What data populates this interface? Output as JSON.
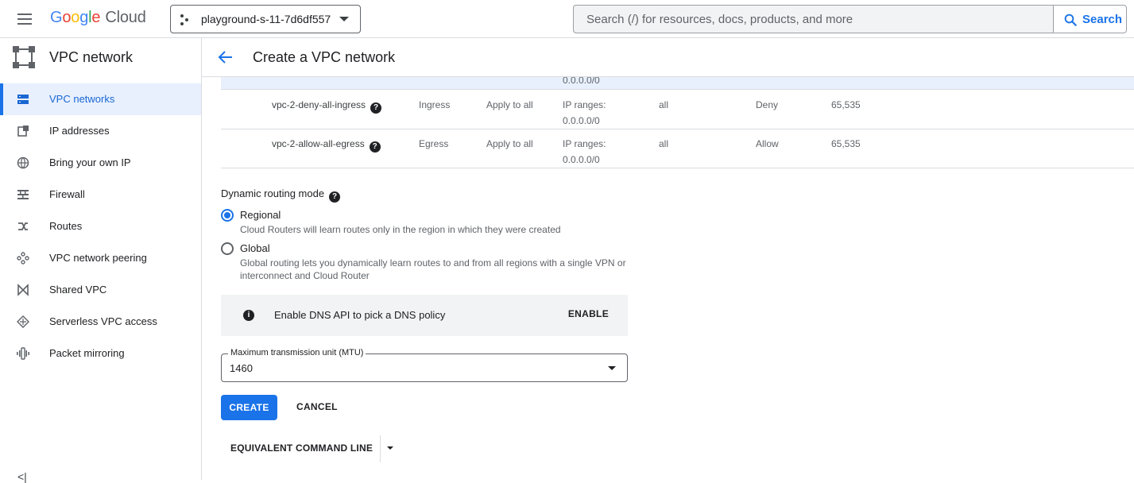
{
  "topbar": {
    "logo_letters": [
      "G",
      "o",
      "o",
      "g",
      "l",
      "e"
    ],
    "logo_suffix": "Cloud",
    "project": "playground-s-11-7d6df557",
    "search_placeholder": "Search (/) for resources, docs, products, and more",
    "search_label": "Search"
  },
  "sidebar": {
    "title": "VPC network",
    "items": [
      {
        "label": "VPC networks",
        "icon": "vpc-networks-icon",
        "active": true
      },
      {
        "label": "IP addresses",
        "icon": "ip-addresses-icon"
      },
      {
        "label": "Bring your own IP",
        "icon": "globe-icon"
      },
      {
        "label": "Firewall",
        "icon": "firewall-icon"
      },
      {
        "label": "Routes",
        "icon": "routes-icon"
      },
      {
        "label": "VPC network peering",
        "icon": "peering-icon"
      },
      {
        "label": "Shared VPC",
        "icon": "shared-vpc-icon"
      },
      {
        "label": "Serverless VPC access",
        "icon": "serverless-icon"
      },
      {
        "label": "Packet mirroring",
        "icon": "packet-mirroring-icon"
      }
    ],
    "collapse_label": "<|"
  },
  "page": {
    "title": "Create a VPC network"
  },
  "firewall_rules": {
    "partial_row_text": "0.0.0.0/0",
    "rows": [
      {
        "name": "vpc-2-deny-all-ingress",
        "direction": "Ingress",
        "targets": "Apply to all",
        "filter_label": "IP ranges:",
        "filter_value": "0.0.0.0/0",
        "protocols": "all",
        "action": "Deny",
        "priority": "65,535"
      },
      {
        "name": "vpc-2-allow-all-egress",
        "direction": "Egress",
        "targets": "Apply to all",
        "filter_label": "IP ranges:",
        "filter_value": "0.0.0.0/0",
        "protocols": "all",
        "action": "Allow",
        "priority": "65,535"
      }
    ]
  },
  "routing": {
    "label": "Dynamic routing mode",
    "options": [
      {
        "label": "Regional",
        "description": "Cloud Routers will learn routes only in the region in which they were created",
        "selected": true
      },
      {
        "label": "Global",
        "description": "Global routing lets you dynamically learn routes to and from all regions with a single VPN or interconnect and Cloud Router",
        "selected": false
      }
    ]
  },
  "dns": {
    "text": "Enable DNS API to pick a DNS policy",
    "action": "ENABLE"
  },
  "mtu": {
    "label": "Maximum transmission unit (MTU)",
    "value": "1460"
  },
  "actions": {
    "create": "CREATE",
    "cancel": "CANCEL",
    "command_line": "EQUIVALENT COMMAND LINE"
  },
  "colors": {
    "accent": "#1a73e8",
    "active_bg": "#e8f0fe",
    "banner_bg": "#f1f3f4"
  }
}
